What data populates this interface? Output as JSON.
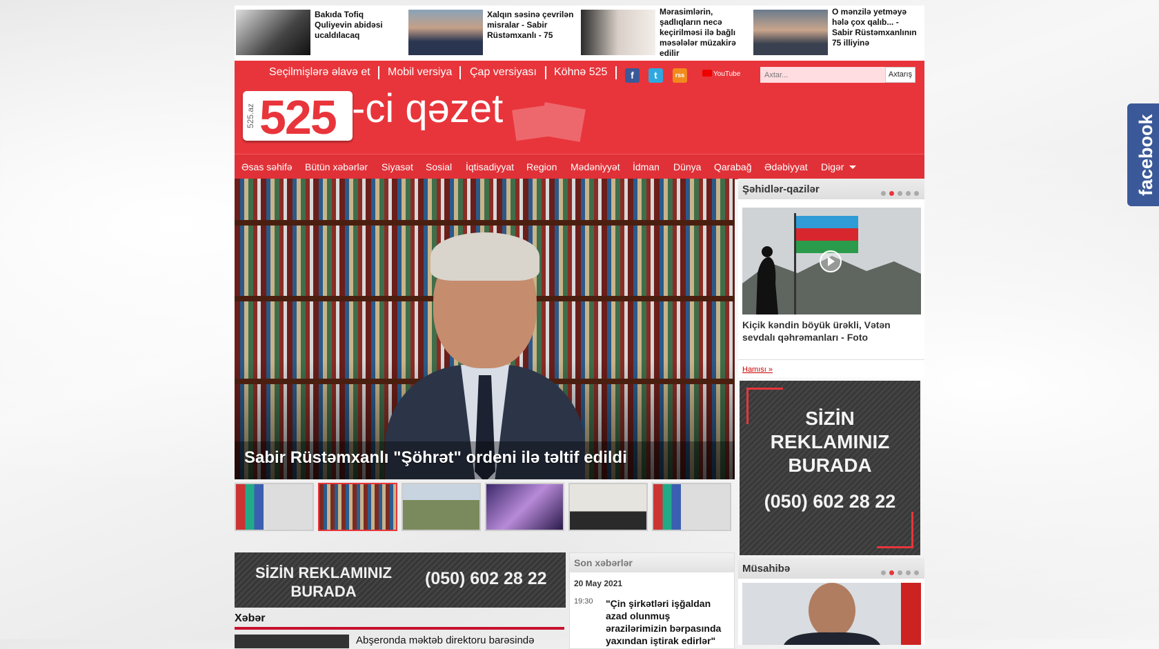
{
  "top_news": [
    {
      "text": "Bakıda Tofiq Quliyevin abidəsi ucaldılacaq"
    },
    {
      "text": "Xalqın səsinə çevrilən misralar - Sabir Rüstəmxanlı - 75"
    },
    {
      "text": "Mərasimlərin, şadlıqların necə keçirilməsi ilə bağlı məsələlər müzakirə edilir"
    },
    {
      "text": "O mənzilə yetməyə hələ çox qalıb... - Sabir Rüstəmxanlının 75 illiyinə"
    }
  ],
  "header_links": [
    "Seçilmişlərə əlavə et",
    "Mobil versiya",
    "Çap versiyası",
    "Köhnə 525"
  ],
  "social": {
    "facebook": "f",
    "twitter": "t",
    "rss": "rss",
    "youtube": "YouTube"
  },
  "search": {
    "placeholder": "Axtar...",
    "button": "Axtarış"
  },
  "logo": {
    "vertical": "525.az",
    "number": "525",
    "tail": "-ci qəzet"
  },
  "nav": [
    "Əsas səhifə",
    "Bütün xəbərlər",
    "Siyasət",
    "Sosial",
    "İqtisadiyyat",
    "Region",
    "Mədəniyyət",
    "İdman",
    "Dünya",
    "Qarabağ",
    "Ədəbiyyat",
    "Digər"
  ],
  "slider": {
    "caption": "Sabir Rüstəmxanlı \"Şöhrət\" ordeni ilə təltif edildi",
    "active_thumb": 1,
    "thumb_count": 6
  },
  "martyrs": {
    "title": "Şəhidlər-qazilər",
    "caption": "Kiçik kəndin böyük ürəkli, Vətən sevdalı qəhrəmanları - Foto",
    "more": "Hamısı »",
    "active_dot": 1,
    "dots": 5
  },
  "ad": {
    "line1": "SİZİN",
    "line2": "REKLAMINIZ",
    "line3": "BURADA",
    "phone": "(050) 602 28 22"
  },
  "interview": {
    "title": "Müsahibə",
    "active_dot": 1,
    "dots": 5
  },
  "news_section": {
    "title": "Xəbər",
    "first_item": "Abşeronda məktəb direktoru barəsində"
  },
  "latest": {
    "title": "Son xəbərlər",
    "date": "20 May 2021",
    "time": "19:30",
    "text": "\"Çin şirkətləri işğaldan azad olunmuş ərazilərimizin bərpasında yaxından iştirak edirlər\""
  },
  "facebook_tab": "facebook",
  "colors": {
    "brand_red": "#e8353b",
    "facebook_blue": "#3b5998"
  }
}
